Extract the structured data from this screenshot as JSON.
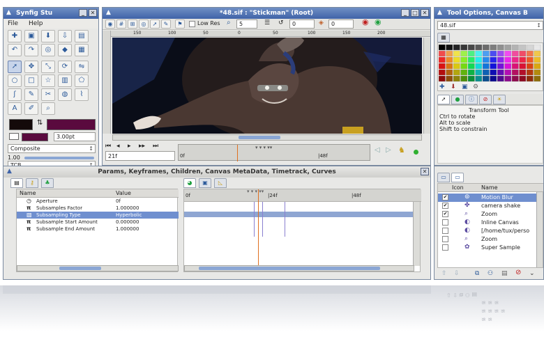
{
  "toolbox": {
    "title": "Synfig Stu",
    "menu": [
      "File",
      "Help"
    ],
    "width_value": "3.00pt",
    "blend_method": "Composite",
    "amount_value": "1.00",
    "interpolation": "TCB"
  },
  "canvas": {
    "title": "*48.sif : \"Stickman\" (Root)",
    "low_res_label": "Low Res",
    "quality_value": "5",
    "onion_past": "0",
    "onion_future": "0",
    "ruler_marks": [
      "150",
      "100",
      "50",
      "0",
      "50",
      "100",
      "150",
      "200"
    ],
    "current_time": "21f",
    "time_start": "0f",
    "time_mid": "|48f",
    "colors": {
      "background": "#0c0f1a",
      "ruler": "#d8d8d4"
    }
  },
  "tool_options": {
    "title": "Tool Options, Canvas B",
    "file_label": "48.sif",
    "tool_name": "Transform Tool",
    "hints": [
      "Ctrl to rotate",
      "Alt to scale",
      "Shift to constrain"
    ]
  },
  "params_panel": {
    "title": "Params, Keyframes, Children, Canvas MetaData, Timetrack, Curves",
    "col_name": "Name",
    "col_value": "Value",
    "rows": [
      {
        "icon": "angle-icon",
        "name": "Aperture",
        "value": "0f"
      },
      {
        "icon": "pi-icon",
        "name": "Subsamples Factor",
        "value": "1.000000"
      },
      {
        "icon": "type-icon",
        "name": "Subsampling Type",
        "value": "Hyperbolic"
      },
      {
        "icon": "pi-icon",
        "name": "Subsample Start Amount",
        "value": "0.000000"
      },
      {
        "icon": "pi-icon",
        "name": "Subsample End Amount",
        "value": "1.000000"
      }
    ],
    "timetrack_start": "0f",
    "timetrack_mid": "|24f",
    "timetrack_end": "|48f"
  },
  "layers_panel": {
    "col_icon": "Icon",
    "col_name": "Name",
    "layers": [
      {
        "checked": "✔",
        "name": "Motion Blur",
        "selected": true
      },
      {
        "checked": "✔",
        "name": "camera shake",
        "selected": false
      },
      {
        "checked": "✔",
        "name": "Zoom",
        "selected": false
      },
      {
        "checked": "",
        "name": "Inline Canvas",
        "selected": false
      },
      {
        "checked": "",
        "name": "[/home/tux/perso",
        "selected": false
      },
      {
        "checked": "",
        "name": "Zoom",
        "selected": false
      },
      {
        "checked": "",
        "name": "Super Sample",
        "selected": false
      }
    ]
  },
  "colors_accent": {
    "titlebar": "#4a6cb0",
    "selection": "#6f8fcf",
    "outline": "#140a0a",
    "fill": "#5a0a3e"
  }
}
